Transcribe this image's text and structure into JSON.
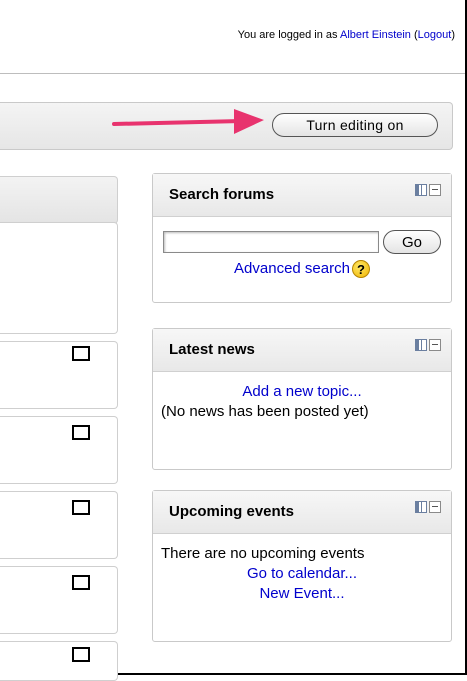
{
  "login": {
    "prefix": "You are logged in as",
    "user": "Albert Einstein",
    "open_paren": "(",
    "logout": "Logout",
    "close_paren": ")"
  },
  "toolbar": {
    "edit_button": "Turn editing on"
  },
  "blocks": {
    "search": {
      "title": "Search forums",
      "input_value": "",
      "go_label": "Go",
      "advanced_link": "Advanced search",
      "help_glyph": "?"
    },
    "news": {
      "title": "Latest news",
      "add_link": "Add a new topic...",
      "empty_text": "(No news has been posted yet)"
    },
    "events": {
      "title": "Upcoming events",
      "empty_text": "There are no upcoming events",
      "calendar_link": "Go to calendar...",
      "new_event_link": "New Event..."
    }
  },
  "colors": {
    "arrow": "#e8336e",
    "link": "#0000cc"
  },
  "icons": [
    "dock-icon",
    "hide-icon",
    "help-icon",
    "arrow-indicator",
    "checkbox"
  ]
}
